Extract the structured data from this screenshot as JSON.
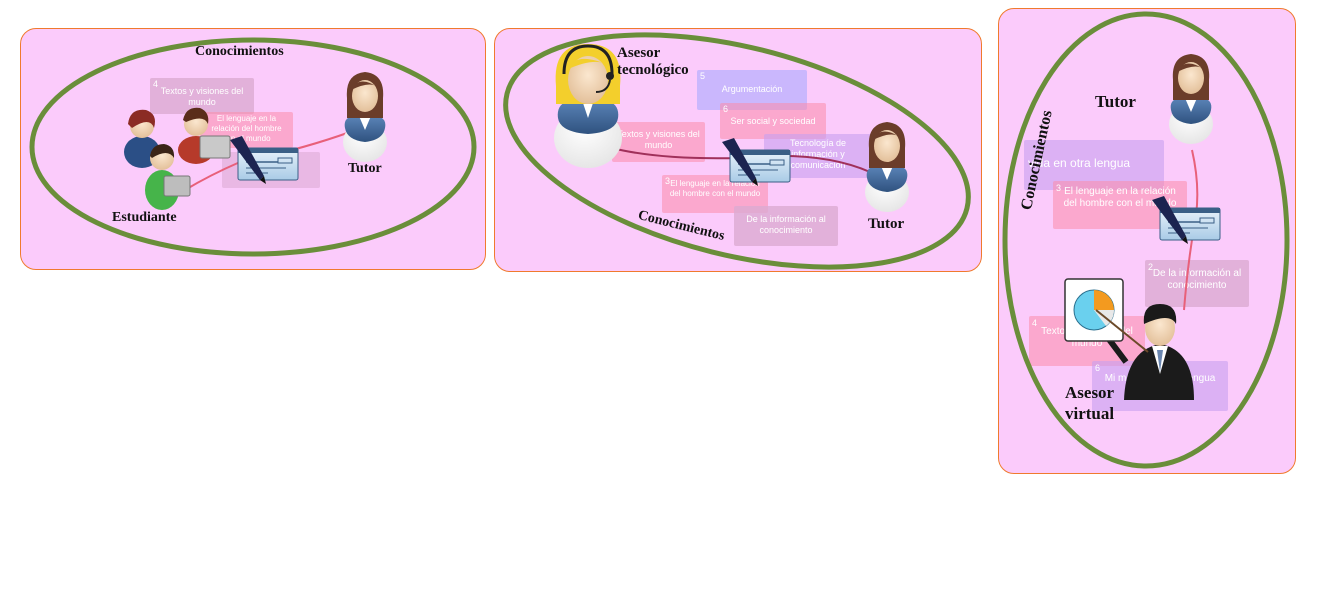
{
  "panel1": {
    "title": "Conocimientos",
    "student_label": "Estudiante",
    "tutor_label": "Tutor",
    "cards": [
      {
        "num": "4",
        "text": "Textos y visiones del mundo"
      },
      {
        "num": "",
        "text": "El lenguaje en la relación del hombre con el mundo"
      }
    ]
  },
  "panel2": {
    "advisor_label_line1": "Asesor",
    "advisor_label_line2": "tecnológico",
    "knowledge_label": "Conocimientos",
    "tutor_label": "Tutor",
    "cards": [
      {
        "num": "5",
        "text": "Argumentación"
      },
      {
        "num": "6",
        "text": "Ser social y sociedad"
      },
      {
        "num": "",
        "text": "Textos y visiones del mundo"
      },
      {
        "num": "",
        "text": "Tecnología de información y comunicación"
      },
      {
        "num": "3",
        "text": "El lenguaje en la relación del hombre con el mundo"
      },
      {
        "num": "",
        "text": "De la información al conocimiento"
      }
    ]
  },
  "panel3": {
    "knowledge_label": "Conocimientos",
    "tutor_label": "Tutor",
    "advisor_label_line1": "Asesor",
    "advisor_label_line2": "virtual",
    "cards": [
      {
        "num": "",
        "text": "vida en otra lengua"
      },
      {
        "num": "3",
        "text": "El lenguaje en la relación del hombre con el mundo"
      },
      {
        "num": "2",
        "text": "De la información al conocimiento"
      },
      {
        "num": "4",
        "text": "Textos y visiones del mundo"
      },
      {
        "num": "6",
        "text": "Mi mundo en otra lengua"
      }
    ]
  },
  "colors": {
    "panel_fill": "#fbcbfb",
    "panel_border": "#f07a2e",
    "ellipse": "#6a8e3a",
    "connector": "#e8607a"
  },
  "icons": [
    "student-group-icon",
    "tutor-icon",
    "document-pen-icon",
    "headset-advisor-icon",
    "presenter-advisor-icon",
    "pie-chart-board-icon"
  ]
}
